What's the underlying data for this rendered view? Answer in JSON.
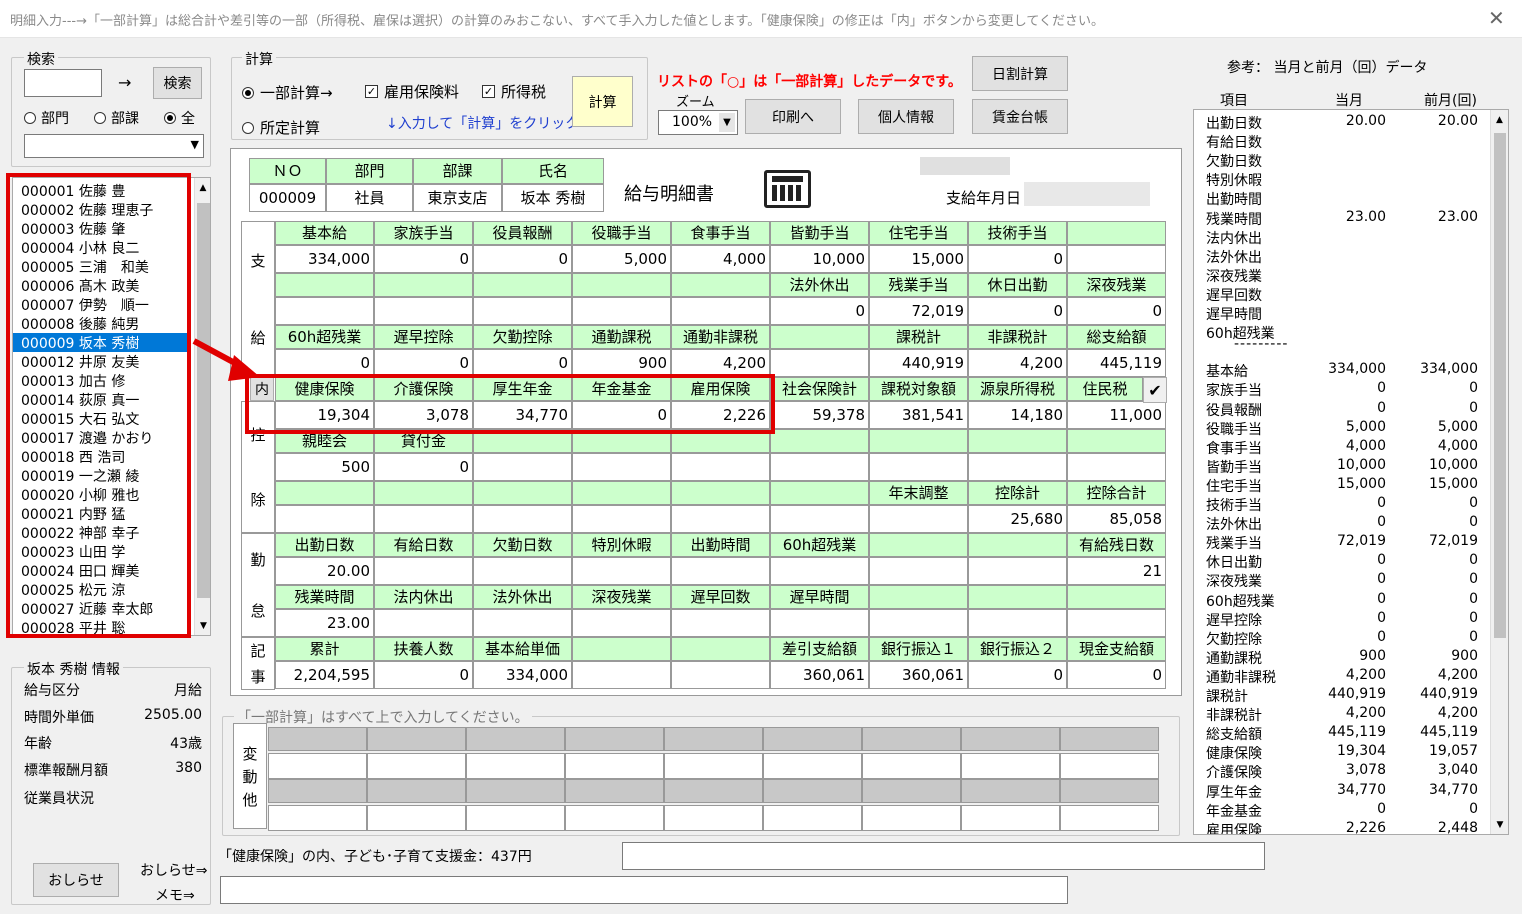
{
  "window": {
    "title": "明細入力---→「一部計算」は総合計や差引等の一部（所得税、雇保は選択）の計算のみおこない、すべて手入力した値とします。「健康保険」の修正は「内」ボタンから変更してください。"
  },
  "search": {
    "legend": "検索",
    "arrow": "→",
    "button": "検索",
    "radios": [
      "部門",
      "部課",
      "全"
    ],
    "selected_radio": "全"
  },
  "calc": {
    "legend": "計算",
    "radio_partial": "一部計算→",
    "radio_fixed": "所定計算",
    "chk_koyo": "雇用保険料",
    "chk_shotoku": "所得税",
    "hint": "↓入力して「計算」をクリック ⇒",
    "calc_button": "計算"
  },
  "notice": "リストの「○」は「一部計算」したデータです。",
  "zoom": {
    "label": "ズーム",
    "value": "100%"
  },
  "buttons": {
    "print": "印刷へ",
    "personal": "個人情報",
    "daily": "日割計算",
    "ledger": "賃金台帳",
    "oshirase": "おしらせ"
  },
  "employees": [
    "000001 佐藤 豊",
    "000002 佐藤 理恵子",
    "000003 佐藤 肇",
    "000004 小林 良二",
    "000005 三浦　和美",
    "000006 髙木 政美",
    "000007 伊勢　順一",
    "000008 後藤 純男",
    "000009 坂本 秀樹",
    "000012 井原 友美",
    "000013 加古 修",
    "000014 荻原 真一",
    "000015 大石 弘文",
    "000017 渡邉 かおり",
    "000018 西 浩司",
    "000019 一之瀬 綾",
    "000020 小柳 雅也",
    "000021 内野 猛",
    "000022 神部 幸子",
    "000023 山田 学",
    "000024 田口 輝美",
    "000025 松元 涼",
    "000027 近藤 幸太郎",
    "000028 平井 聡"
  ],
  "selected_employee": "000009 坂本 秀樹",
  "info": {
    "legend": "坂本 秀樹 情報",
    "rows": [
      {
        "k": "給与区分",
        "v": "月給"
      },
      {
        "k": "時間外単価",
        "v": "2505.00"
      },
      {
        "k": "年齢",
        "v": "43歳"
      },
      {
        "k": "標準報酬月額",
        "v": "380"
      },
      {
        "k": "従業員状況",
        "v": ""
      }
    ],
    "oshirase_link": "おしらせ⇒",
    "memo_link": "メモ⇒"
  },
  "slip": {
    "header_labels": [
      "ＮＯ",
      "部門",
      "部課",
      "氏名"
    ],
    "header_values": [
      "000009",
      "社員",
      "東京支店",
      "坂本 秀樹"
    ],
    "title": "給与明細書",
    "pay_date_label": "支給年月日",
    "sec_shikyu": [
      "支",
      "給"
    ],
    "sec_koujo": [
      "控",
      "除"
    ],
    "sec_kintai": [
      "勤",
      "怠"
    ],
    "sec_kiji": [
      "記",
      "事"
    ],
    "uchi": "内",
    "check": "✔",
    "rows": [
      {
        "h": [
          "基本給",
          "家族手当",
          "役員報酬",
          "役職手当",
          "食事手当",
          "皆勤手当",
          "住宅手当",
          "技術手当",
          ""
        ],
        "v": [
          "334,000",
          "0",
          "0",
          "5,000",
          "4,000",
          "10,000",
          "15,000",
          "0",
          ""
        ]
      },
      {
        "h": [
          "",
          "",
          "",
          "",
          "",
          "法外休出",
          "残業手当",
          "休日出勤",
          "深夜残業"
        ],
        "v": [
          "",
          "",
          "",
          "",
          "",
          "0",
          "72,019",
          "0",
          "0"
        ]
      },
      {
        "h": [
          "60h超残業",
          "遅早控除",
          "欠勤控除",
          "通勤課税",
          "通勤非課税",
          "",
          "課税計",
          "非課税計",
          "総支給額"
        ],
        "v": [
          "0",
          "0",
          "0",
          "900",
          "4,200",
          "",
          "440,919",
          "4,200",
          "445,119"
        ]
      },
      {
        "h": [
          "健康保険",
          "介護保険",
          "厚生年金",
          "年金基金",
          "雇用保険",
          "社会保険計",
          "課税対象額",
          "源泉所得税",
          "住民税"
        ],
        "v": [
          "19,304",
          "3,078",
          "34,770",
          "0",
          "2,226",
          "59,378",
          "381,541",
          "14,180",
          "11,000"
        ]
      },
      {
        "h": [
          "親睦会",
          "貸付金",
          "",
          "",
          "",
          "",
          "",
          "",
          ""
        ],
        "v": [
          "500",
          "0",
          "",
          "",
          "",
          "",
          "",
          "",
          ""
        ]
      },
      {
        "h": [
          "",
          "",
          "",
          "",
          "",
          "",
          "年末調整",
          "控除計",
          "控除合計"
        ],
        "v": [
          "",
          "",
          "",
          "",
          "",
          "",
          "",
          "25,680",
          "85,058"
        ]
      },
      {
        "h": [
          "出勤日数",
          "有給日数",
          "欠勤日数",
          "特別休暇",
          "出勤時間",
          "60h超残業",
          "",
          "",
          "有給残日数"
        ],
        "v": [
          "20.00",
          "",
          "",
          "",
          "",
          "",
          "",
          "",
          "21"
        ]
      },
      {
        "h": [
          "残業時間",
          "法内休出",
          "法外休出",
          "深夜残業",
          "遅早回数",
          "遅早時間",
          "",
          "",
          ""
        ],
        "v": [
          "23.00",
          "",
          "",
          "",
          "",
          "",
          "",
          "",
          ""
        ]
      },
      {
        "h": [
          "累計",
          "扶養人数",
          "基本給単価",
          "",
          "",
          "差引支給額",
          "銀行振込１",
          "銀行振込２",
          "現金支給額"
        ],
        "v": [
          "2,204,595",
          "0",
          "334,000",
          "",
          "",
          "360,061",
          "360,061",
          "0",
          "0"
        ]
      }
    ]
  },
  "partial": {
    "legend": "「一部計算」はすべて上で入力してください。",
    "side": [
      "変",
      "動",
      "他"
    ]
  },
  "footer": {
    "note": "「健康保険」の内、子ども･子育て支援金：437円"
  },
  "ref": {
    "title": "参考： 当月と前月（回）データ",
    "cols": [
      "項目",
      "当月",
      "前月(回)"
    ],
    "divider": "---------",
    "rows": [
      [
        "出勤日数",
        "20.00",
        "20.00"
      ],
      [
        "有給日数",
        "",
        ""
      ],
      [
        "欠勤日数",
        "",
        ""
      ],
      [
        "特別休暇",
        "",
        ""
      ],
      [
        "出勤時間",
        "",
        ""
      ],
      [
        "残業時間",
        "23.00",
        "23.00"
      ],
      [
        "法内休出",
        "",
        ""
      ],
      [
        "法外休出",
        "",
        ""
      ],
      [
        "深夜残業",
        "",
        ""
      ],
      [
        "遅早回数",
        "",
        ""
      ],
      [
        "遅早時間",
        "",
        ""
      ],
      [
        "60h超残業",
        "",
        ""
      ]
    ],
    "rows2": [
      [
        "基本給",
        "334,000",
        "334,000"
      ],
      [
        "家族手当",
        "0",
        "0"
      ],
      [
        "役員報酬",
        "0",
        "0"
      ],
      [
        "役職手当",
        "5,000",
        "5,000"
      ],
      [
        "食事手当",
        "4,000",
        "4,000"
      ],
      [
        "皆勤手当",
        "10,000",
        "10,000"
      ],
      [
        "住宅手当",
        "15,000",
        "15,000"
      ],
      [
        "技術手当",
        "0",
        "0"
      ],
      [
        "法外休出",
        "0",
        "0"
      ],
      [
        "残業手当",
        "72,019",
        "72,019"
      ],
      [
        "休日出勤",
        "0",
        "0"
      ],
      [
        "深夜残業",
        "0",
        "0"
      ],
      [
        "60h超残業",
        "0",
        "0"
      ],
      [
        "遅早控除",
        "0",
        "0"
      ],
      [
        "欠勤控除",
        "0",
        "0"
      ],
      [
        "通勤課税",
        "900",
        "900"
      ],
      [
        "通勤非課税",
        "4,200",
        "4,200"
      ],
      [
        "課税計",
        "440,919",
        "440,919"
      ],
      [
        "非課税計",
        "4,200",
        "4,200"
      ],
      [
        "総支給額",
        "445,119",
        "445,119"
      ],
      [
        "健康保険",
        "19,304",
        "19,057"
      ],
      [
        "介護保険",
        "3,078",
        "3,040"
      ],
      [
        "厚生年金",
        "34,770",
        "34,770"
      ],
      [
        "年金基金",
        "0",
        "0"
      ],
      [
        "雇用保険",
        "2,226",
        "2,448"
      ]
    ]
  },
  "colors": {
    "header_green": "#ccffcc",
    "highlight_red": "#e00000",
    "selection_blue": "#0078d7",
    "notice_red": "#ff0000",
    "calc_button_yellow": "#ffffcc"
  }
}
